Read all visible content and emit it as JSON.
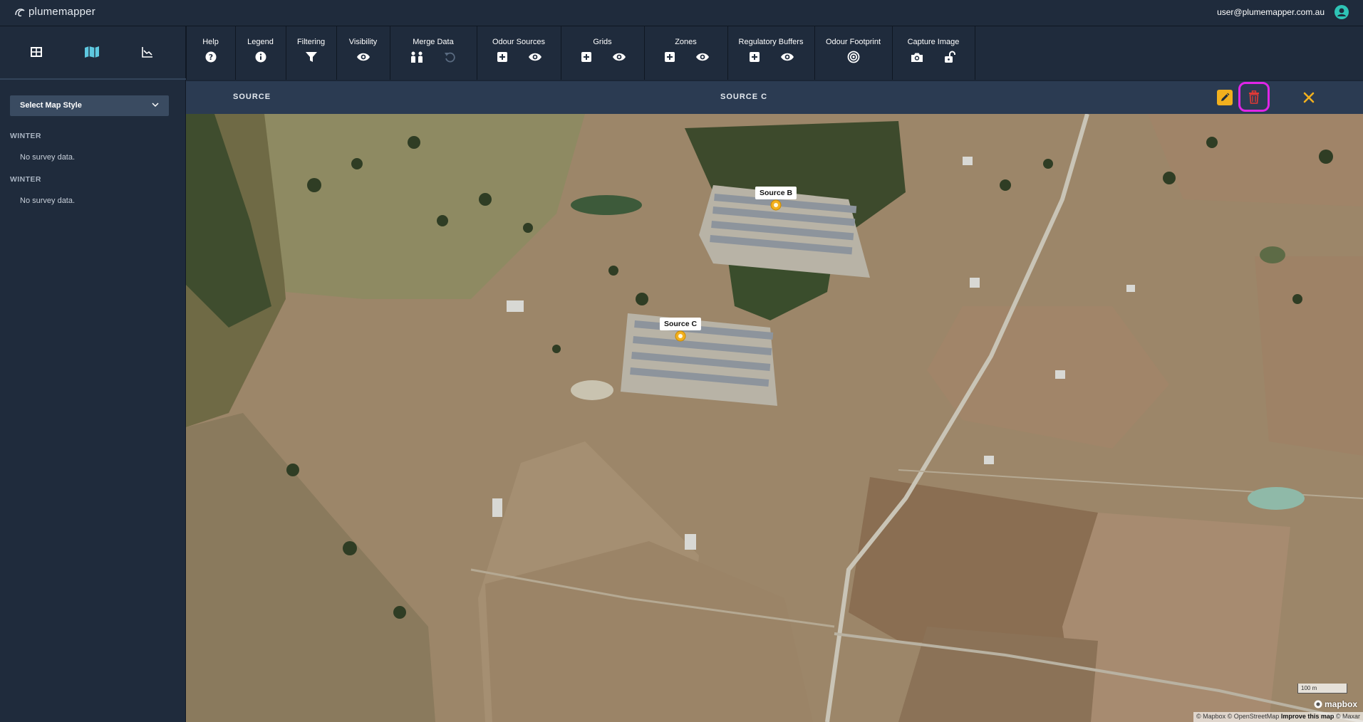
{
  "app": {
    "logo_text": "plumemapper",
    "user_email": "user@plumemapper.com.au"
  },
  "sidebar": {
    "view_tabs": [
      {
        "name": "table-view",
        "icon": "table-icon",
        "active": false
      },
      {
        "name": "map-view",
        "icon": "map-icon",
        "active": true
      },
      {
        "name": "chart-view",
        "icon": "chart-icon",
        "active": false
      }
    ],
    "map_style_label": "Select Map Style",
    "seasons": [
      {
        "heading": "WINTER",
        "note": "No survey data."
      },
      {
        "heading": "WINTER",
        "note": "No survey data."
      }
    ]
  },
  "toolbar": {
    "groups": [
      {
        "label": "Help",
        "icons": [
          "help-icon"
        ]
      },
      {
        "label": "Legend",
        "icons": [
          "info-icon"
        ]
      },
      {
        "label": "Filtering",
        "icons": [
          "filter-icon"
        ]
      },
      {
        "label": "Visibility",
        "icons": [
          "eye-icon"
        ]
      },
      {
        "label": "Merge Data",
        "icons": [
          "merge-icon",
          "undo-icon"
        ]
      },
      {
        "label": "Odour Sources",
        "icons": [
          "add-icon",
          "eye-icon"
        ]
      },
      {
        "label": "Grids",
        "icons": [
          "add-icon",
          "eye-icon"
        ]
      },
      {
        "label": "Zones",
        "icons": [
          "add-icon",
          "eye-icon"
        ]
      },
      {
        "label": "Regulatory Buffers",
        "icons": [
          "add-icon",
          "eye-icon"
        ]
      },
      {
        "label": "Odour Footprint",
        "icons": [
          "target-icon"
        ]
      },
      {
        "label": "Capture Image",
        "icons": [
          "camera-icon",
          "unlock-icon"
        ]
      }
    ]
  },
  "source_bar": {
    "label": "SOURCE",
    "name": "SOURCE C"
  },
  "map": {
    "markers": [
      {
        "label": "Source B"
      },
      {
        "label": "Source C"
      }
    ],
    "scale": "100 m",
    "logo": "mapbox",
    "attribution_1": "© Mapbox © OpenStreetMap",
    "attribution_2": "Improve this map",
    "attribution_3": "© Maxar"
  },
  "colors": {
    "accent": "#f2b01e",
    "highlight": "#e025e8",
    "delete": "#e53935",
    "marker": "#f2b01e"
  }
}
